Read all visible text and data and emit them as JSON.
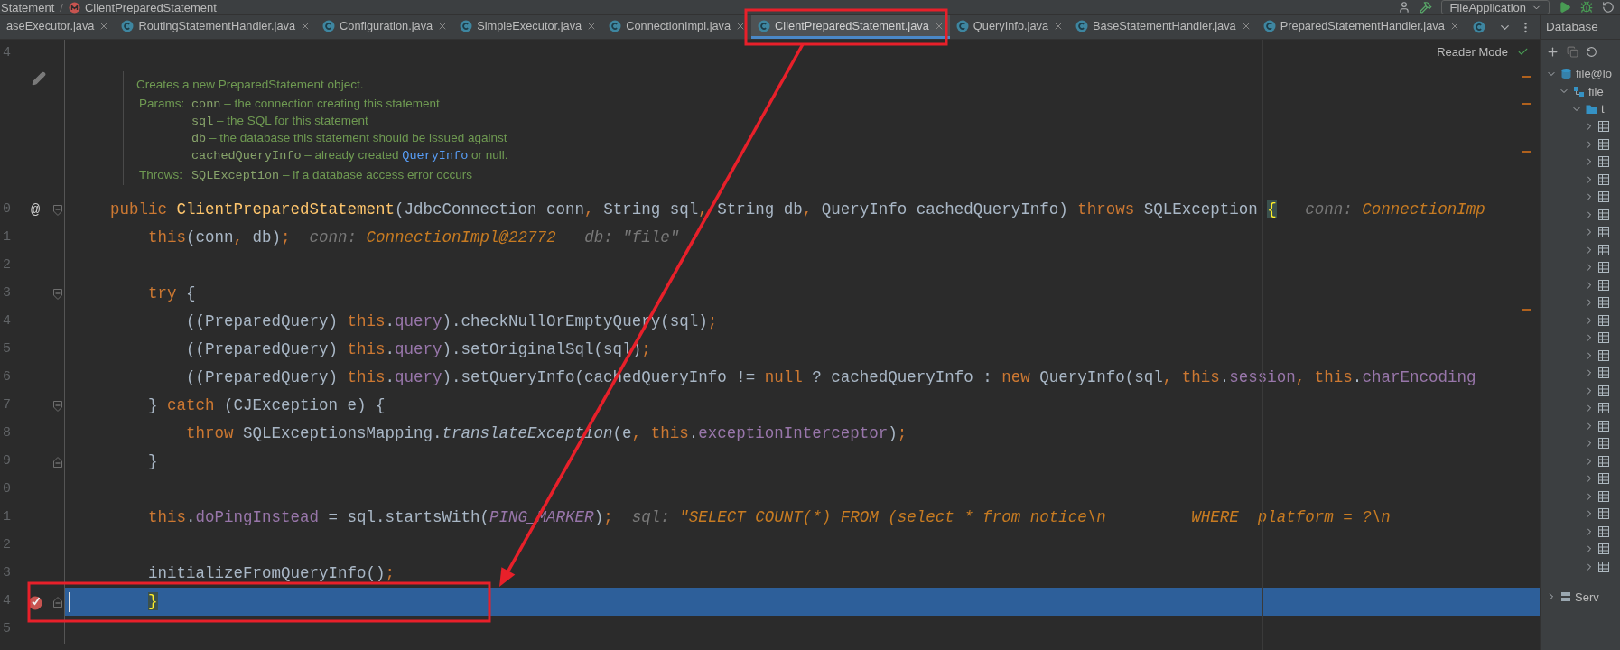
{
  "breadcrumb": {
    "items": [
      "Statement",
      "ClientPreparedStatement"
    ],
    "separator": "/"
  },
  "toolbar": {
    "run_config": "FileApplication"
  },
  "tabs": [
    {
      "label": "aseExecutor.java",
      "icon": false,
      "selected": false
    },
    {
      "label": "RoutingStatementHandler.java",
      "icon": true,
      "selected": false
    },
    {
      "label": "Configuration.java",
      "icon": true,
      "selected": false
    },
    {
      "label": "SimpleExecutor.java",
      "icon": true,
      "selected": false
    },
    {
      "label": "ConnectionImpl.java",
      "icon": true,
      "selected": false
    },
    {
      "label": "ClientPreparedStatement.java",
      "icon": true,
      "selected": true
    },
    {
      "label": "QueryInfo.java",
      "icon": true,
      "selected": false
    },
    {
      "label": "BaseStatementHandler.java",
      "icon": true,
      "selected": false
    },
    {
      "label": "PreparedStatementHandler.java",
      "icon": true,
      "selected": false
    }
  ],
  "editor": {
    "reader_mode": "Reader Mode",
    "top_line": "4",
    "doc": {
      "summary": "Creates a new PreparedStatement object.",
      "params_label": "Params:",
      "params": [
        {
          "name": "conn",
          "parts": [
            {
              "kind": "text",
              "text": " – the connection creating this statement"
            }
          ]
        },
        {
          "name": "sql",
          "parts": [
            {
              "kind": "text",
              "text": " – the SQL for this statement"
            }
          ]
        },
        {
          "name": "db",
          "parts": [
            {
              "kind": "text",
              "text": " – the database this statement should be issued against"
            }
          ]
        },
        {
          "name": "cachedQueryInfo",
          "parts": [
            {
              "kind": "text",
              "text": " – already created "
            },
            {
              "kind": "link",
              "text": "QueryInfo"
            },
            {
              "kind": "text",
              "text": " or null."
            }
          ]
        }
      ],
      "throws_label": "Throws:",
      "throws": [
        {
          "name": "SQLException",
          "parts": [
            {
              "kind": "text",
              "text": " – if a database access error occurs"
            }
          ]
        }
      ]
    },
    "lines": [
      {
        "number": "0",
        "mark": {
          "kind": "text",
          "text": "@"
        },
        "fold": {
          "kind": "start"
        },
        "current": false,
        "tokens": [
          {
            "kind": "keyword",
            "text": "public "
          },
          {
            "kind": "decl",
            "text": "ClientPreparedStatement"
          },
          {
            "kind": "plain",
            "text": "(JdbcConnection conn"
          },
          {
            "kind": "punct",
            "text": ", "
          },
          {
            "kind": "plain",
            "text": "String sql"
          },
          {
            "kind": "punct",
            "text": ", "
          },
          {
            "kind": "plain",
            "text": "String db"
          },
          {
            "kind": "punct",
            "text": ", "
          },
          {
            "kind": "plain",
            "text": "QueryInfo cachedQueryInfo) "
          },
          {
            "kind": "keyword",
            "text": "throws "
          },
          {
            "kind": "plain",
            "text": "SQLException "
          },
          {
            "kind": "match",
            "text": "{"
          },
          {
            "kind": "hint_label",
            "text": "   conn: "
          },
          {
            "kind": "hint_value",
            "text": "ConnectionImp"
          }
        ]
      },
      {
        "number": "1",
        "current": false,
        "tokens": [
          {
            "kind": "keyword",
            "text": "    this"
          },
          {
            "kind": "plain",
            "text": "(conn"
          },
          {
            "kind": "punct",
            "text": ", "
          },
          {
            "kind": "plain",
            "text": "db)"
          },
          {
            "kind": "punct",
            "text": ";"
          },
          {
            "kind": "hint_label",
            "text": "  conn: "
          },
          {
            "kind": "hint_value",
            "text": "ConnectionImpl@22772"
          },
          {
            "kind": "hint_label",
            "text": "   db: \"file\""
          }
        ]
      },
      {
        "number": "2",
        "current": false
      },
      {
        "number": "3",
        "fold": {
          "kind": "start"
        },
        "current": false,
        "tokens": [
          {
            "kind": "keyword",
            "text": "    try "
          },
          {
            "kind": "plain",
            "text": "{"
          }
        ]
      },
      {
        "number": "4",
        "current": false,
        "tokens": [
          {
            "kind": "plain",
            "text": "        ((PreparedQuery) "
          },
          {
            "kind": "keyword",
            "text": "this"
          },
          {
            "kind": "plain",
            "text": "."
          },
          {
            "kind": "field",
            "text": "query"
          },
          {
            "kind": "plain",
            "text": ").checkNullOrEmptyQuery(sql)"
          },
          {
            "kind": "punct",
            "text": ";"
          }
        ]
      },
      {
        "number": "5",
        "current": false,
        "tokens": [
          {
            "kind": "plain",
            "text": "        ((PreparedQuery) "
          },
          {
            "kind": "keyword",
            "text": "this"
          },
          {
            "kind": "plain",
            "text": "."
          },
          {
            "kind": "field",
            "text": "query"
          },
          {
            "kind": "plain",
            "text": ").setOriginalSql(sql)"
          },
          {
            "kind": "punct",
            "text": ";"
          }
        ]
      },
      {
        "number": "6",
        "current": false,
        "tokens": [
          {
            "kind": "plain",
            "text": "        ((PreparedQuery) "
          },
          {
            "kind": "keyword",
            "text": "this"
          },
          {
            "kind": "plain",
            "text": "."
          },
          {
            "kind": "field",
            "text": "query"
          },
          {
            "kind": "plain",
            "text": ").setQueryInfo(cachedQueryInfo != "
          },
          {
            "kind": "keyword",
            "text": "null"
          },
          {
            "kind": "plain",
            "text": " ? cachedQueryInfo : "
          },
          {
            "kind": "keyword",
            "text": "new "
          },
          {
            "kind": "plain",
            "text": "QueryInfo(sql"
          },
          {
            "kind": "punct",
            "text": ", "
          },
          {
            "kind": "keyword",
            "text": "this"
          },
          {
            "kind": "plain",
            "text": "."
          },
          {
            "kind": "field",
            "text": "session"
          },
          {
            "kind": "punct",
            "text": ", "
          },
          {
            "kind": "keyword",
            "text": "this"
          },
          {
            "kind": "plain",
            "text": "."
          },
          {
            "kind": "field",
            "text": "charEncoding"
          }
        ]
      },
      {
        "number": "7",
        "fold": {
          "kind": "start"
        },
        "current": false,
        "tokens": [
          {
            "kind": "plain",
            "text": "    } "
          },
          {
            "kind": "keyword",
            "text": "catch "
          },
          {
            "kind": "plain",
            "text": "(CJException e) {"
          }
        ]
      },
      {
        "number": "8",
        "current": false,
        "tokens": [
          {
            "kind": "keyword",
            "text": "        throw "
          },
          {
            "kind": "plain",
            "text": "SQLExceptionsMapping."
          },
          {
            "kind": "static",
            "text": "translateException"
          },
          {
            "kind": "plain",
            "text": "(e"
          },
          {
            "kind": "punct",
            "text": ", "
          },
          {
            "kind": "keyword",
            "text": "this"
          },
          {
            "kind": "plain",
            "text": "."
          },
          {
            "kind": "field",
            "text": "exceptionInterceptor"
          },
          {
            "kind": "plain",
            "text": ")"
          },
          {
            "kind": "punct",
            "text": ";"
          }
        ]
      },
      {
        "number": "9",
        "fold": {
          "kind": "end"
        },
        "current": false,
        "tokens": [
          {
            "kind": "plain",
            "text": "    }"
          }
        ]
      },
      {
        "number": "0",
        "current": false
      },
      {
        "number": "1",
        "current": false,
        "tokens": [
          {
            "kind": "keyword",
            "text": "    this"
          },
          {
            "kind": "plain",
            "text": "."
          },
          {
            "kind": "field",
            "text": "doPingInstead"
          },
          {
            "kind": "plain",
            "text": " = sql.startsWith("
          },
          {
            "kind": "constant",
            "text": "PING_MARKER"
          },
          {
            "kind": "plain",
            "text": ")"
          },
          {
            "kind": "punct",
            "text": ";"
          },
          {
            "kind": "hint_label",
            "text": "  sql: "
          },
          {
            "kind": "hint_value",
            "text": "\"SELECT COUNT(*) FROM (select * from notice\\n         WHERE  platform = ?\\n"
          }
        ]
      },
      {
        "number": "2",
        "current": false
      },
      {
        "number": "3",
        "current": false,
        "tokens": [
          {
            "kind": "plain",
            "text": "    initializeFromQueryInfo()"
          },
          {
            "kind": "punct",
            "text": ";"
          }
        ]
      },
      {
        "number": "4",
        "mark": {
          "kind": "breakpoint"
        },
        "fold": {
          "kind": "end"
        },
        "current": true,
        "tokens": [
          {
            "kind": "match",
            "text": "    }"
          }
        ]
      },
      {
        "number": "5",
        "current": false
      }
    ]
  },
  "database": {
    "title": "Database",
    "tree": [
      {
        "label": "file@lo",
        "kind": "datasource",
        "expanded": true,
        "children": [
          {
            "label": "file",
            "kind": "schema",
            "expanded": true,
            "children": [
              {
                "label": "t",
                "kind": "folder",
                "expanded": true,
                "children": [
                  {
                    "kind": "table",
                    "expanded": false
                  },
                  {
                    "kind": "table",
                    "expanded": false
                  },
                  {
                    "kind": "table",
                    "expanded": false
                  },
                  {
                    "kind": "table",
                    "expanded": false
                  },
                  {
                    "kind": "table",
                    "expanded": false
                  },
                  {
                    "kind": "table",
                    "expanded": false
                  },
                  {
                    "kind": "table",
                    "expanded": false
                  },
                  {
                    "kind": "table",
                    "expanded": false
                  },
                  {
                    "kind": "table",
                    "expanded": false
                  },
                  {
                    "kind": "table",
                    "expanded": false
                  },
                  {
                    "kind": "table",
                    "expanded": false
                  },
                  {
                    "kind": "table",
                    "expanded": false
                  },
                  {
                    "kind": "table",
                    "expanded": false
                  },
                  {
                    "kind": "table",
                    "expanded": false
                  },
                  {
                    "kind": "table",
                    "expanded": false
                  },
                  {
                    "kind": "table",
                    "expanded": false
                  },
                  {
                    "kind": "table",
                    "expanded": false
                  },
                  {
                    "kind": "table",
                    "expanded": false
                  },
                  {
                    "kind": "table",
                    "expanded": false
                  },
                  {
                    "kind": "table",
                    "expanded": false
                  },
                  {
                    "kind": "table",
                    "expanded": false
                  },
                  {
                    "kind": "table",
                    "expanded": false
                  },
                  {
                    "kind": "table",
                    "expanded": false
                  },
                  {
                    "kind": "table",
                    "expanded": false
                  },
                  {
                    "kind": "table",
                    "expanded": false
                  },
                  {
                    "kind": "table",
                    "expanded": false
                  }
                ]
              }
            ]
          }
        ]
      },
      {
        "label": "Serv",
        "kind": "server",
        "expanded": false
      }
    ]
  },
  "annotations": [
    {
      "kind": "box"
    },
    {
      "kind": "arrow"
    },
    {
      "kind": "box"
    }
  ]
}
